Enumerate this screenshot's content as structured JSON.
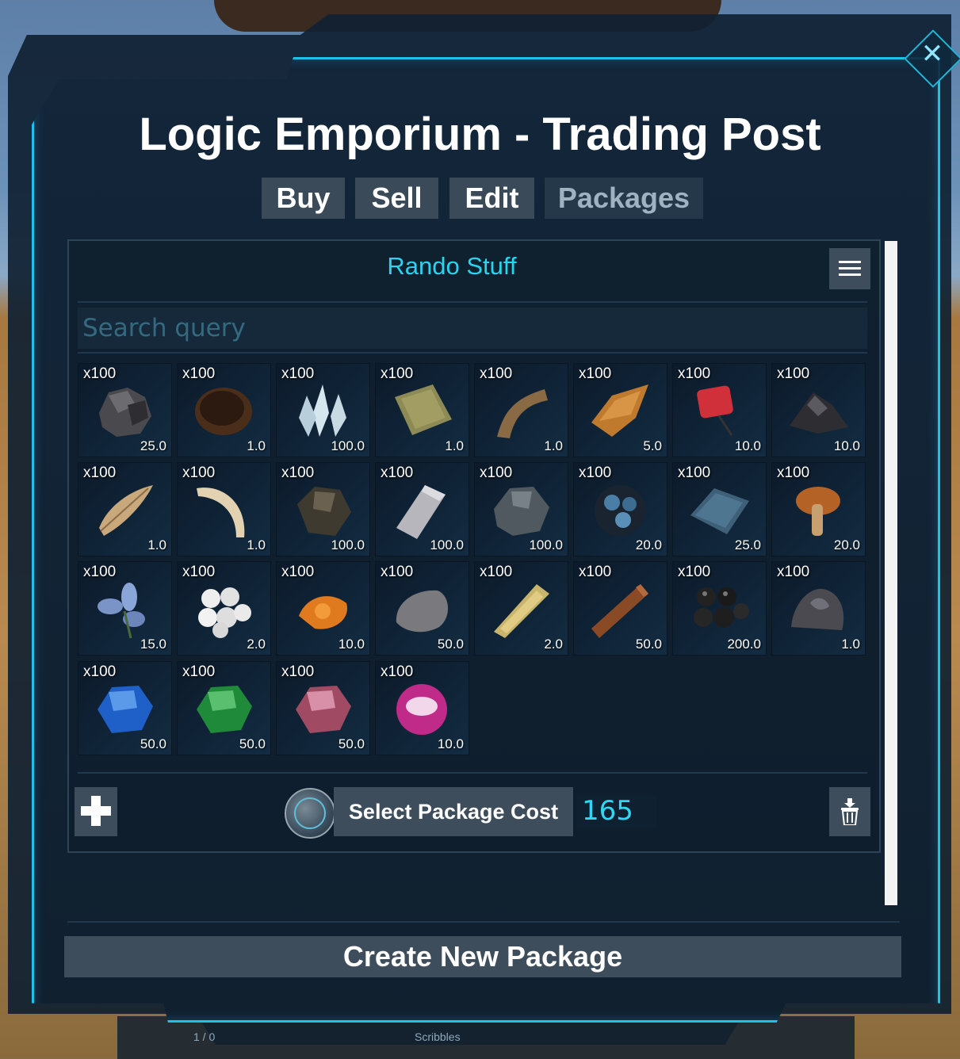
{
  "window": {
    "title": "Logic Emporium - Trading Post",
    "close_icon": "close-icon"
  },
  "tabs": [
    {
      "label": "Buy",
      "active": false
    },
    {
      "label": "Sell",
      "active": false
    },
    {
      "label": "Edit",
      "active": false
    },
    {
      "label": "Packages",
      "active": true
    }
  ],
  "package": {
    "name": "Rando Stuff",
    "menu_icon": "hamburger-menu-icon"
  },
  "search": {
    "placeholder": "Search query",
    "value": ""
  },
  "items": [
    {
      "qty": "x100",
      "weight": "25.0",
      "icon": "metal-ore-icon"
    },
    {
      "qty": "x100",
      "weight": "1.0",
      "icon": "hide-icon"
    },
    {
      "qty": "x100",
      "weight": "100.0",
      "icon": "crystal-icon"
    },
    {
      "qty": "x100",
      "weight": "1.0",
      "icon": "cloth-icon"
    },
    {
      "qty": "x100",
      "weight": "1.0",
      "icon": "fiber-icon"
    },
    {
      "qty": "x100",
      "weight": "5.0",
      "icon": "chitin-icon"
    },
    {
      "qty": "x100",
      "weight": "10.0",
      "icon": "gasoline-icon"
    },
    {
      "qty": "x100",
      "weight": "10.0",
      "icon": "gunpowder-icon"
    },
    {
      "qty": "x100",
      "weight": "1.0",
      "icon": "feather-icon"
    },
    {
      "qty": "x100",
      "weight": "1.0",
      "icon": "tusk-icon"
    },
    {
      "qty": "x100",
      "weight": "100.0",
      "icon": "obsidian-icon"
    },
    {
      "qty": "x100",
      "weight": "100.0",
      "icon": "metal-ingot-icon"
    },
    {
      "qty": "x100",
      "weight": "100.0",
      "icon": "stone-chunk-icon"
    },
    {
      "qty": "x100",
      "weight": "20.0",
      "icon": "blue-ore-icon"
    },
    {
      "qty": "x100",
      "weight": "25.0",
      "icon": "polymer-icon"
    },
    {
      "qty": "x100",
      "weight": "20.0",
      "icon": "mushroom-icon"
    },
    {
      "qty": "x100",
      "weight": "15.0",
      "icon": "flower-icon"
    },
    {
      "qty": "x100",
      "weight": "2.0",
      "icon": "pearls-icon"
    },
    {
      "qty": "x100",
      "weight": "10.0",
      "icon": "sparkpowder-icon"
    },
    {
      "qty": "x100",
      "weight": "50.0",
      "icon": "stone-icon"
    },
    {
      "qty": "x100",
      "weight": "2.0",
      "icon": "thatch-icon"
    },
    {
      "qty": "x100",
      "weight": "50.0",
      "icon": "wood-icon"
    },
    {
      "qty": "x100",
      "weight": "200.0",
      "icon": "black-pearls-icon"
    },
    {
      "qty": "x100",
      "weight": "1.0",
      "icon": "element-dust-icon"
    },
    {
      "qty": "x100",
      "weight": "50.0",
      "icon": "blue-gem-icon"
    },
    {
      "qty": "x100",
      "weight": "50.0",
      "icon": "green-gem-icon"
    },
    {
      "qty": "x100",
      "weight": "50.0",
      "icon": "red-gem-icon"
    },
    {
      "qty": "x100",
      "weight": "10.0",
      "icon": "pink-orb-icon"
    }
  ],
  "footer": {
    "add_icon": "plus-icon",
    "coin_icon": "logic-coin-icon",
    "cost_button": "Select Package Cost",
    "cost_value": "165",
    "delete_icon": "trash-icon"
  },
  "create_button": "Create New Package",
  "hotbar": {
    "slot1_label": "1 / 0",
    "slot4_label": "Scribbles"
  },
  "colors": {
    "accent": "#1cc3e6",
    "cyan_text": "#28d5f0",
    "button_bg": "#3e4d5b",
    "panel_bg": "#10202f"
  }
}
